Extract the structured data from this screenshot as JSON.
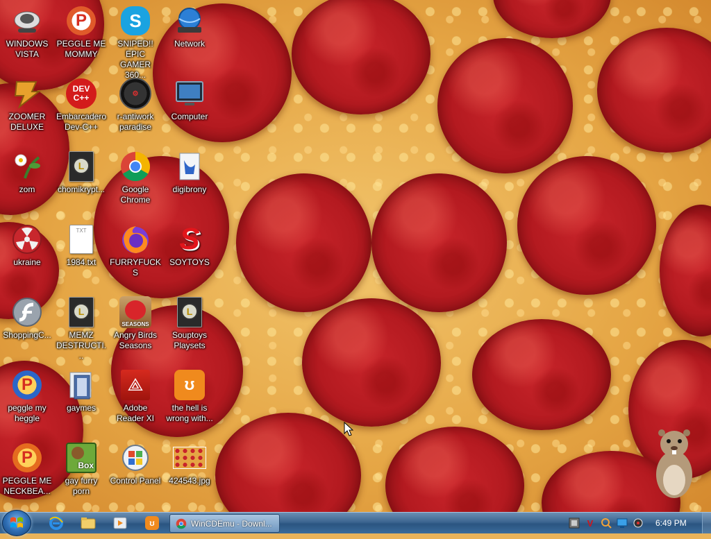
{
  "desktop": {
    "icons": [
      {
        "label": "WINDOWS VISTA"
      },
      {
        "label": "PEGGLE ME MOMMY"
      },
      {
        "label": "SNIPED!! EPIC GAMER 360..."
      },
      {
        "label": "Network"
      },
      {
        "label": "ZOOMER DELUXE"
      },
      {
        "label": "Embarcadero Dev-C++"
      },
      {
        "label": "r-antiwork paradise"
      },
      {
        "label": "Computer"
      },
      {
        "label": "zom"
      },
      {
        "label": "chomikrypt..."
      },
      {
        "label": "Google Chrome"
      },
      {
        "label": "digibrony"
      },
      {
        "label": "ukraine"
      },
      {
        "label": "1984.txt"
      },
      {
        "label": "FURRYFUCKS"
      },
      {
        "label": "SOYTOYS"
      },
      {
        "label": "ShoppingC..."
      },
      {
        "label": "MEMZ DESTRUCTI..."
      },
      {
        "label": "Angry Birds Seasons"
      },
      {
        "label": "Souptoys Playsets"
      },
      {
        "label": "peggle my heggle"
      },
      {
        "label": "gaymes"
      },
      {
        "label": "Adobe Reader XI"
      },
      {
        "label": "the hell is wrong with..."
      },
      {
        "label": "PEGGLE ME NECKBEA..."
      },
      {
        "label": "gay furry porn"
      },
      {
        "label": "Control Panel"
      },
      {
        "label": "424543.jpg"
      }
    ],
    "icon_glyphs": {
      "dev_cpp": "DEV C++",
      "box": "Box",
      "txt": "TXT",
      "seasons": "SEASONS"
    }
  },
  "taskbar": {
    "active_window_label": "WinCDEmu - Downl...",
    "clock": "6:49 PM"
  },
  "colors": {
    "taskbar": "#2b5581",
    "pepperoni": "#b41a20",
    "cheese": "#e5a544"
  }
}
